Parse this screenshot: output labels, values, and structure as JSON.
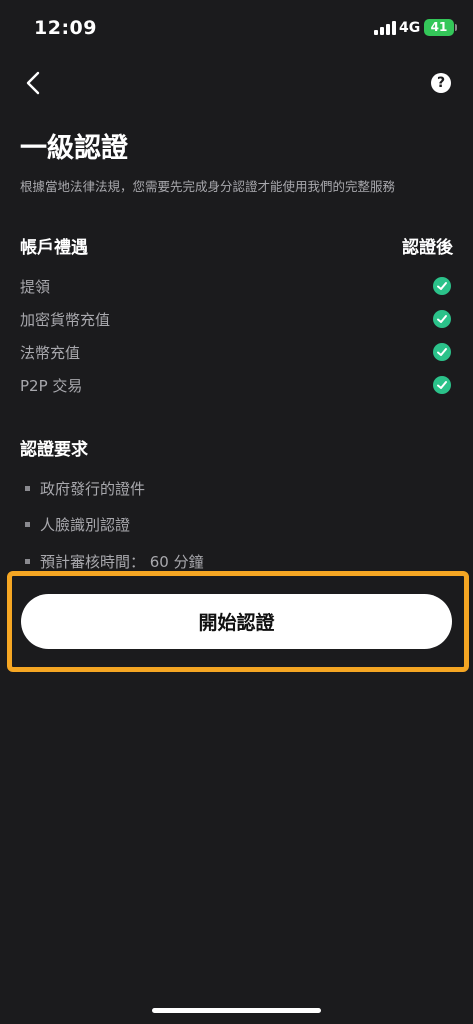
{
  "status_bar": {
    "time": "12:09",
    "network": "4G",
    "battery": "41"
  },
  "header": {
    "back_icon": "chevron-left-icon",
    "help_icon": "question-circle-icon",
    "help_glyph": "?"
  },
  "page": {
    "title": "一級認證",
    "subtitle": "根據當地法律法規，您需要先完成身分認證才能使用我們的完整服務"
  },
  "benefits": {
    "title": "帳戶禮遇",
    "column_header": "認證後",
    "items": [
      {
        "label": "提領"
      },
      {
        "label": "加密貨幣充值"
      },
      {
        "label": "法幣充值"
      },
      {
        "label": "P2P 交易"
      }
    ],
    "check_color": "#2bc28a"
  },
  "requirements": {
    "title": "認證要求",
    "items": [
      {
        "label": "政府發行的證件"
      },
      {
        "label": "人臉識別認證"
      },
      {
        "label": "預計審核時間： 60 分鐘"
      }
    ]
  },
  "cta": {
    "label": "開始認證",
    "highlight_color": "#f5a623"
  }
}
